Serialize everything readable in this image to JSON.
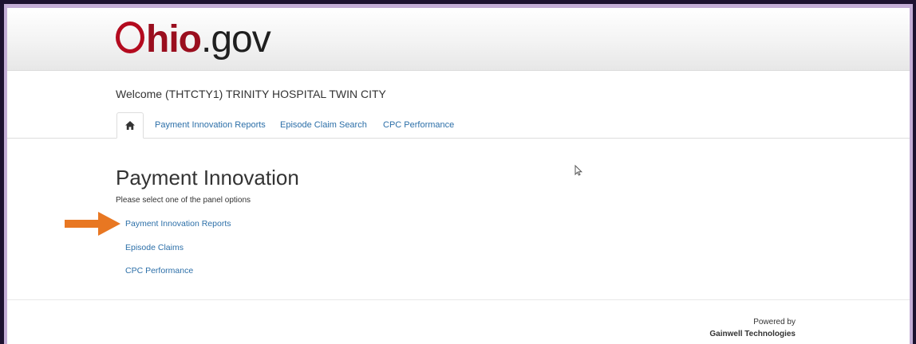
{
  "header": {
    "logo_o": "O",
    "logo_hio": "hio",
    "logo_gov": ".gov"
  },
  "welcome": "Welcome (THTCTY1) TRINITY HOSPITAL TWIN CITY",
  "tabs": [
    {
      "label": "Payment Innovation Reports"
    },
    {
      "label": "Episode Claim Search"
    },
    {
      "label": "CPC Performance"
    }
  ],
  "main": {
    "title": "Payment Innovation",
    "instruction": "Please select one of the panel options",
    "links": [
      {
        "label": "Payment Innovation Reports"
      },
      {
        "label": "Episode Claims"
      },
      {
        "label": "CPC Performance"
      }
    ]
  },
  "footer": {
    "powered_by": "Powered by",
    "company": "Gainwell Technologies"
  },
  "colors": {
    "brand_red": "#9a0e1e",
    "link_blue": "#2c6fa8",
    "annotation_arrow": "#e87722"
  }
}
